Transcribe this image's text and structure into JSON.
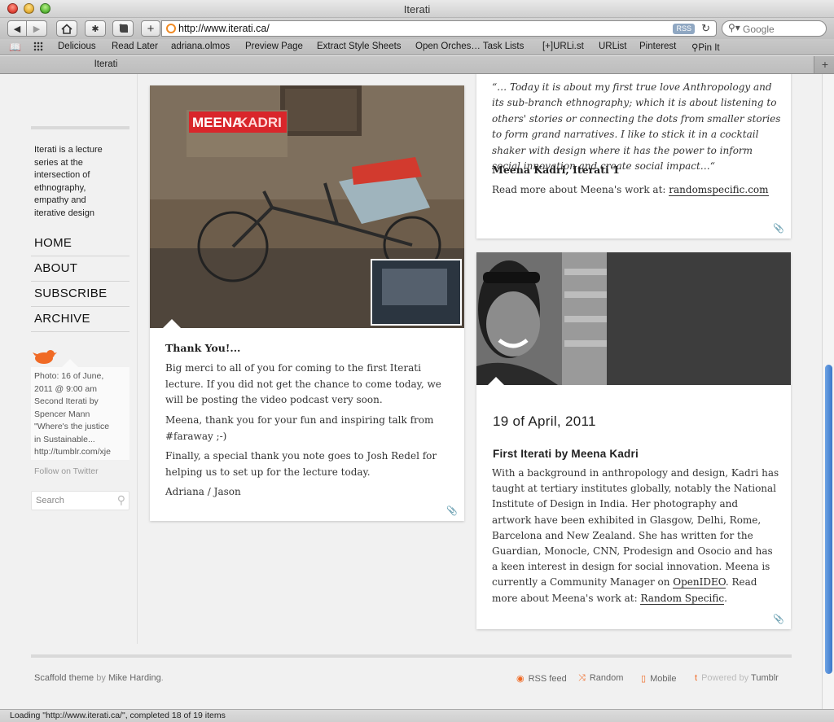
{
  "window": {
    "title": "Iterati"
  },
  "toolbar": {
    "url": "http://www.iterati.ca/",
    "rss_badge": "RSS",
    "search_placeholder": "Google"
  },
  "bookmarks": [
    "Delicious",
    "Read Later",
    "adriana.olmos",
    "Preview Page",
    "Extract Style Sheets",
    "Open Orches… Task Lists",
    "[+]URLi.st",
    "URList",
    "Pinterest",
    "⚲Pin It"
  ],
  "tabs": [
    {
      "label": "Iterati"
    }
  ],
  "sidebar": {
    "description": [
      "Iterati is a lecture",
      "series at the",
      "intersection of",
      "ethnography,",
      "empathy and",
      "iterative design"
    ],
    "nav": [
      "HOME",
      "ABOUT",
      "SUBSCRIBE",
      "ARCHIVE"
    ],
    "tweet": [
      "Photo: 16 of June,",
      "2011 @ 9:00 am",
      "Second Iterati by",
      "Spencer Mann",
      "\"Where's the justice",
      "in Sustainable...",
      "http://tumblr.com/xje"
    ],
    "follow": "Follow on Twitter",
    "search_placeholder": "Search"
  },
  "post_left": {
    "sign_text_1": "MEENA",
    "sign_text_2": "KADRI",
    "title": "Thank You!...",
    "paragraphs": [
      "Big merci to all of you for coming to the first Iterati lecture.  If you did not get the chance to come today, we will be posting the video podcast very soon.",
      "Meena, thank you for your fun and inspiring talk from #faraway ;-)",
      "Finally, a special thank you note goes to Josh Redel for helping us to set up for the lecture today.",
      "Adriana / Jason"
    ]
  },
  "post_quote": {
    "quote": "“… Today it is about my first true love Anthropology and its sub-branch ethnography; which it is about listening to others' stories or connecting the dots from smaller stories to form grand narratives. I like to stick it in a cocktail shaker with design where it has the power to inform social innovation and create social impact…“",
    "author": "Meena Kadri, Iterati 1",
    "more_prefix": "Read more about Meena's work at: ",
    "more_link": "randomspecific.com"
  },
  "post_meena": {
    "date": "19 of April, 2011",
    "title": "First Iterati by Meena Kadri",
    "body_1": "With a background in anthropology and design, Kadri has taught at tertiary institutes globally, notably the National Institute of Design in India. Her photography and artwork have been exhibited in Glasgow, Delhi, Rome, Barcelona and New Zealand. She has written for the Guardian, Monocle, CNN, Prodesign and Osocio and has a keen interest in design for social innovation. Meena is currently a Community Manager on ",
    "link_1": "OpenIDEO",
    "body_2": ".  Read more about Meena's work at: ",
    "link_2": "Random Specific",
    "body_3": "."
  },
  "footer": {
    "theme_prefix": "Scaffold theme",
    "by": "by",
    "author": "Mike Harding",
    "rss": "RSS feed",
    "random": "Random",
    "mobile": "Mobile",
    "powered": "Powered by",
    "tumblr": "Tumblr"
  },
  "status": {
    "text": "Loading \"http://www.iterati.ca/\", completed 18 of 19 items"
  },
  "colors": {
    "accent_orange": "#f06a25",
    "scroll_blue": "#3b78c9",
    "sign_red": "#d9262b"
  }
}
